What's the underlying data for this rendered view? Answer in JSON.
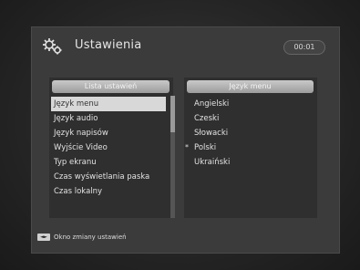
{
  "header": {
    "title": "Ustawienia",
    "clock": "00:01",
    "icon": "gear-icon"
  },
  "left_panel": {
    "header": "Lista ustawień",
    "items": [
      "Język menu",
      "Język audio",
      "Język napisów",
      "Wyjście Video",
      "Typ ekranu",
      "Czas wyświetlania paska",
      "Czas lokalny"
    ],
    "selected_index": 0
  },
  "right_panel": {
    "header": "Język menu",
    "items": [
      "Angielski",
      "Czeski",
      "Słowacki",
      "Polski",
      "Ukraiński"
    ],
    "checked_index": 3,
    "check_glyph": "*"
  },
  "footer": {
    "key_label": "◄►",
    "hint": "Okno zmiany ustawień"
  },
  "colors": {
    "background": "#262626",
    "panel": "#2f2f2f",
    "selection": "#d8d8d8",
    "text": "#e2e2e2"
  }
}
